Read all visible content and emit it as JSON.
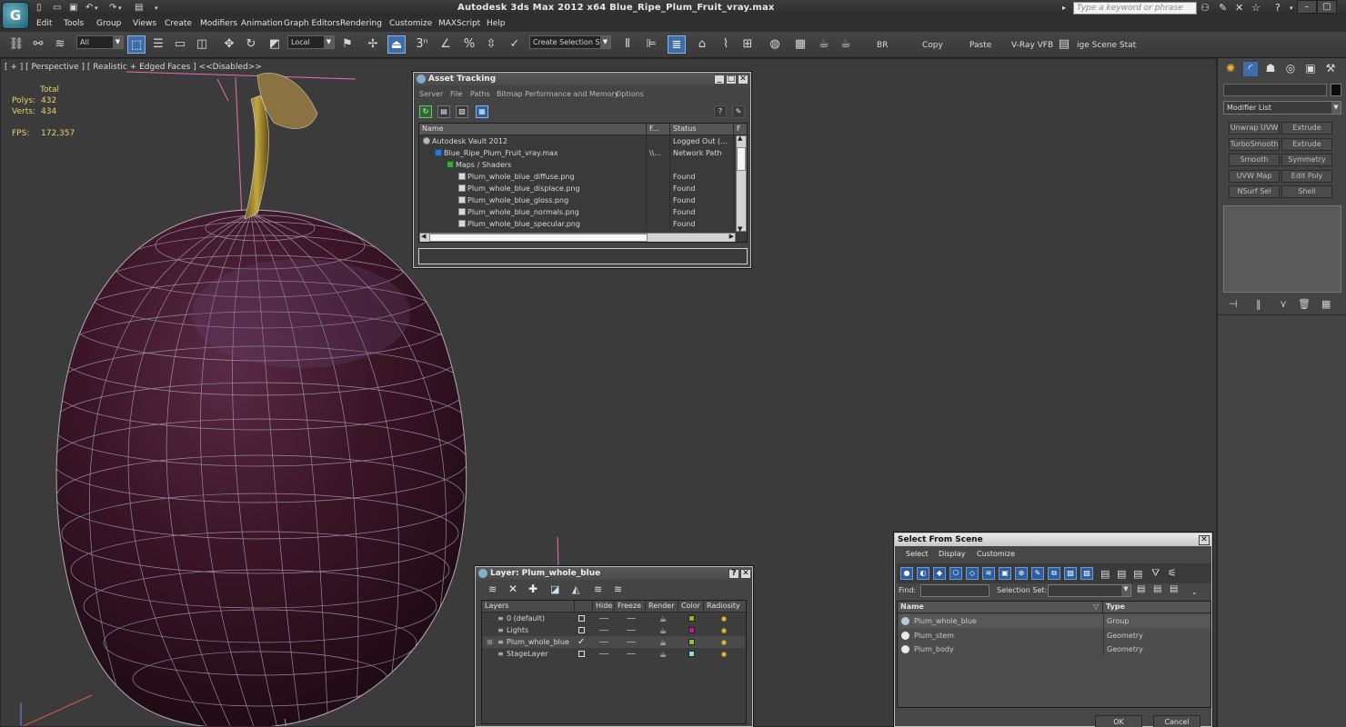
{
  "app": {
    "title": "Autodesk 3ds Max  2012 x64     Blue_Ripe_Plum_Fruit_vray.max",
    "logo_letter": "G",
    "search_placeholder": "Type a keyword or phrase"
  },
  "menu": [
    "Edit",
    "Tools",
    "Group",
    "Views",
    "Create",
    "Modifiers",
    "Animation",
    "Graph Editors",
    "Rendering",
    "Customize",
    "MAXScript",
    "Help"
  ],
  "toolbar": {
    "filter": "All",
    "coord": "Local",
    "selection_set": "Create Selection Se",
    "snap3": "3",
    "text_buttons": [
      "BR",
      "Copy",
      "Paste",
      "V-Ray VFB",
      "ige Scene Stat"
    ]
  },
  "viewport": {
    "label": "[ + ] [ Perspective ] [ Realistic + Edged Faces ]  <<Disabled>>",
    "stats": {
      "header": "Total",
      "polys_label": "Polys:",
      "polys": "432",
      "verts_label": "Verts:",
      "verts": "434",
      "fps_label": "FPS:",
      "fps": "172,357"
    },
    "colors": {
      "bg": "#3b3b3b",
      "plum_dark": "#2a1219",
      "plum_mid": "#4a1f2f",
      "wire": "#a8a0b4",
      "gizmo": "#e86db0"
    }
  },
  "command_panel": {
    "modifier_list": "Modifier List",
    "buttons": [
      [
        "Unwrap UVW",
        "Extrude"
      ],
      [
        "TurboSmooth",
        "Extrude"
      ],
      [
        "Smooth",
        "Symmetry"
      ],
      [
        "UVW Map",
        "Edit Poly"
      ],
      [
        "NSurf Sel",
        "Shell"
      ]
    ]
  },
  "asset_tracking": {
    "title": "Asset Tracking",
    "menu": [
      "Server",
      "File",
      "Paths",
      "Bitmap Performance and Memory",
      "Options"
    ],
    "columns": [
      "Name",
      "F...",
      "Status",
      "F"
    ],
    "rows": [
      {
        "name": "Autodesk Vault 2012",
        "f": "",
        "status": "Logged Out (...",
        "indent": 0,
        "type": "vault"
      },
      {
        "name": "Blue_Ripe_Plum_Fruit_vray.max",
        "f": "\\\\...",
        "status": "Network Path",
        "indent": 1,
        "type": "max"
      },
      {
        "name": "Maps / Shaders",
        "f": "",
        "status": "",
        "indent": 2,
        "type": "folder"
      },
      {
        "name": "Plum_whole_blue_diffuse.png",
        "f": "",
        "status": "Found",
        "indent": 3,
        "type": "file"
      },
      {
        "name": "Plum_whole_blue_displace.png",
        "f": "",
        "status": "Found",
        "indent": 3,
        "type": "file"
      },
      {
        "name": "Plum_whole_blue_gloss.png",
        "f": "",
        "status": "Found",
        "indent": 3,
        "type": "file"
      },
      {
        "name": "Plum_whole_blue_normals.png",
        "f": "",
        "status": "Found",
        "indent": 3,
        "type": "file"
      },
      {
        "name": "Plum_whole_blue_specular.png",
        "f": "",
        "status": "Found",
        "indent": 3,
        "type": "file"
      }
    ]
  },
  "layer_dialog": {
    "title": "Layer: Plum_whole_blue",
    "columns": [
      "Layers",
      "Hide",
      "Freeze",
      "Render",
      "Color",
      "Radiosity"
    ],
    "rows": [
      {
        "name": "0 (default)",
        "current": false,
        "color": "#9ab02a"
      },
      {
        "name": "Lights",
        "current": false,
        "color": "#c21a9a"
      },
      {
        "name": "Plum_whole_blue",
        "current": true,
        "color": "#8fc23a"
      },
      {
        "name": "StageLayer",
        "current": false,
        "color": "#8fe0c8"
      }
    ]
  },
  "select_from_scene": {
    "title": "Select From Scene",
    "menu": [
      "Select",
      "Display",
      "Customize"
    ],
    "find_label": "Find:",
    "selection_set_label": "Selection Set:",
    "columns": [
      "Name",
      "Type"
    ],
    "rows": [
      {
        "name": "Plum_whole_blue",
        "type": "Group",
        "icon": "group"
      },
      {
        "name": "Plum_stem",
        "type": "Geometry",
        "icon": "geo"
      },
      {
        "name": "Plum_body",
        "type": "Geometry",
        "icon": "geo"
      }
    ],
    "ok": "OK",
    "cancel": "Cancel"
  }
}
